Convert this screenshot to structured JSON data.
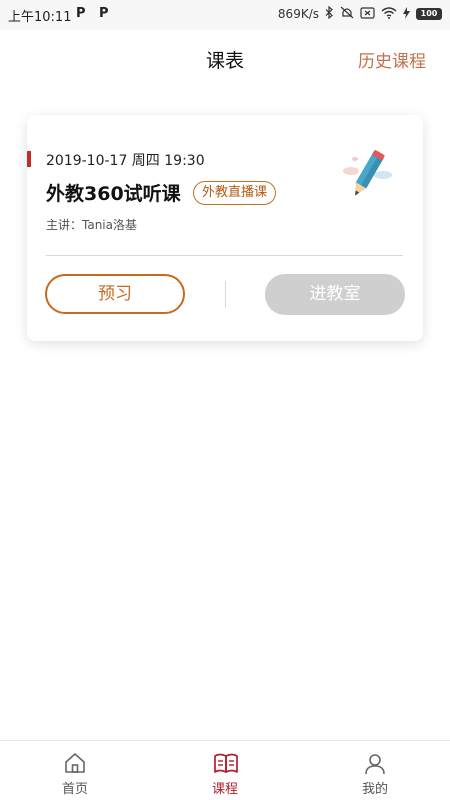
{
  "status_bar": {
    "time": "上午10:11",
    "app_icons": [
      "P",
      "P"
    ],
    "network_speed": "869K/s",
    "battery_level": "100"
  },
  "header": {
    "title": "课表",
    "history_link": "历史课程"
  },
  "course_card": {
    "datetime": "2019-10-17  周四  19:30",
    "title": "外教360试听课",
    "tag": "外教直播课",
    "teacher": "主讲：Tania洛基",
    "preview_button": "预习",
    "enter_button": "进教室",
    "accent_color": "#c42a2a",
    "preview_color": "#c86a1e"
  },
  "tabbar": {
    "items": [
      {
        "label": "首页",
        "icon": "home-icon",
        "active": false
      },
      {
        "label": "课程",
        "icon": "book-icon",
        "active": true
      },
      {
        "label": "我的",
        "icon": "user-icon",
        "active": false
      }
    ],
    "active_color": "#b21f2b"
  }
}
